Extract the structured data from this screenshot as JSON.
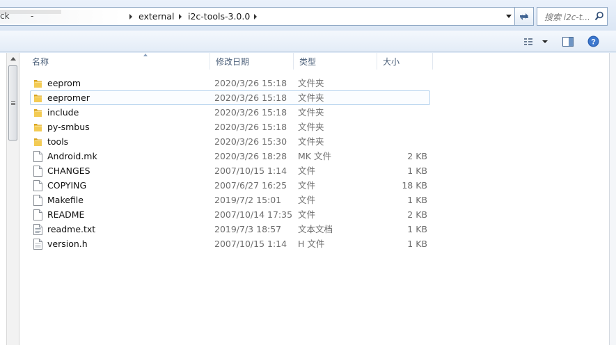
{
  "address": {
    "blur_fragment_left": "ck",
    "blur_fragment_mid": "-",
    "crumbs": [
      "external",
      "i2c-tools-3.0.0"
    ]
  },
  "search": {
    "placeholder": "搜索 i2c-t..."
  },
  "toolbar": {
    "view_icon": "view-options-icon",
    "preview_icon": "preview-pane-icon",
    "help_icon": "help-icon",
    "help_label": "?"
  },
  "columns": {
    "name": "名称",
    "date": "修改日期",
    "type": "类型",
    "size": "大小"
  },
  "files": [
    {
      "name": "eeprom",
      "date": "2020/3/26 15:18",
      "type": "文件夹",
      "size": "",
      "icon": "folder-icon"
    },
    {
      "name": "eepromer",
      "date": "2020/3/26 15:18",
      "type": "文件夹",
      "size": "",
      "icon": "folder-icon",
      "selected": true
    },
    {
      "name": "include",
      "date": "2020/3/26 15:18",
      "type": "文件夹",
      "size": "",
      "icon": "folder-icon"
    },
    {
      "name": "py-smbus",
      "date": "2020/3/26 15:18",
      "type": "文件夹",
      "size": "",
      "icon": "folder-icon"
    },
    {
      "name": "tools",
      "date": "2020/3/26 15:30",
      "type": "文件夹",
      "size": "",
      "icon": "folder-icon"
    },
    {
      "name": "Android.mk",
      "date": "2020/3/26 18:28",
      "type": "MK 文件",
      "size": "2 KB",
      "icon": "file-icon"
    },
    {
      "name": "CHANGES",
      "date": "2007/10/15 1:14",
      "type": "文件",
      "size": "1 KB",
      "icon": "file-icon"
    },
    {
      "name": "COPYING",
      "date": "2007/6/27 16:25",
      "type": "文件",
      "size": "18 KB",
      "icon": "file-icon"
    },
    {
      "name": "Makefile",
      "date": "2019/7/2 15:01",
      "type": "文件",
      "size": "1 KB",
      "icon": "file-icon"
    },
    {
      "name": "README",
      "date": "2007/10/14 17:35",
      "type": "文件",
      "size": "2 KB",
      "icon": "file-icon"
    },
    {
      "name": "readme.txt",
      "date": "2019/7/3 18:57",
      "type": "文本文档",
      "size": "1 KB",
      "icon": "text-file-icon"
    },
    {
      "name": "version.h",
      "date": "2007/10/15 1:14",
      "type": "H 文件",
      "size": "1 KB",
      "icon": "header-file-icon"
    }
  ],
  "colors": {
    "selection_border": "#b6d3ee",
    "accent": "#2c4a73"
  }
}
